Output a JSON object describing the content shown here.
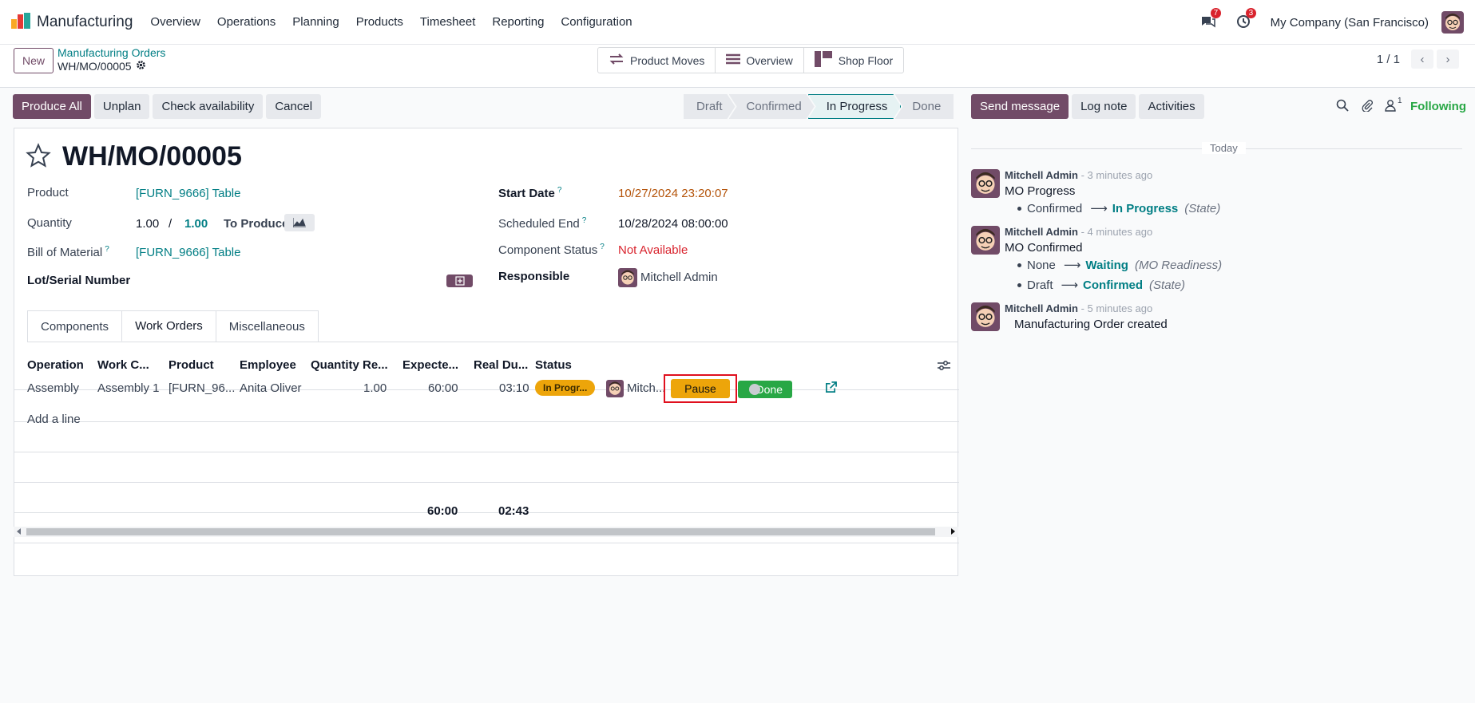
{
  "app": {
    "name": "Manufacturing",
    "menu": [
      "Overview",
      "Operations",
      "Planning",
      "Products",
      "Timesheet",
      "Reporting",
      "Configuration"
    ],
    "messages_count": "7",
    "activities_count": "3",
    "company": "My Company (San Francisco)"
  },
  "control_panel": {
    "new_label": "New",
    "breadcrumb_parent": "Manufacturing Orders",
    "breadcrumb_current": "WH/MO/00005",
    "smart_buttons": [
      "Product Moves",
      "Overview",
      "Shop Floor"
    ],
    "pager": "1 / 1"
  },
  "statusbar": {
    "buttons": [
      "Produce All",
      "Unplan",
      "Check availability",
      "Cancel"
    ],
    "stages": [
      "Draft",
      "Confirmed",
      "In Progress",
      "Done"
    ],
    "active_stage": "In Progress"
  },
  "form": {
    "title": "WH/MO/00005",
    "product_label": "Product",
    "product_value": "[FURN_9666] Table",
    "quantity_label": "Quantity",
    "quantity_value": "1.00",
    "quantity_sep": "/",
    "quantity_total": "1.00",
    "to_produce": "To Produce",
    "bom_label": "Bill of Material",
    "bom_value": "[FURN_9666] Table",
    "lot_label": "Lot/Serial Number",
    "start_label": "Start Date",
    "start_value": "10/27/2024 23:20:07",
    "sched_label": "Scheduled End",
    "sched_value": "10/28/2024 08:00:00",
    "comp_label": "Component Status",
    "comp_value": "Not Available",
    "resp_label": "Responsible",
    "resp_value": "Mitchell Admin",
    "help_mark": "?"
  },
  "tabs": [
    "Components",
    "Work Orders",
    "Miscellaneous"
  ],
  "work_orders": {
    "headers": [
      "Operation",
      "Work C...",
      "Product",
      "Employee",
      "Quantity Re...",
      "Expecte...",
      "Real Du...",
      "Status"
    ],
    "row": {
      "operation": "Assembly",
      "workcenter": "Assembly 1",
      "product": "[FURN_96...",
      "employee": "Anita Oliver",
      "quantity": "1.00",
      "expected": "60:00",
      "real": "03:10",
      "status": "In Progr...",
      "user": "Mitch...",
      "pause": "Pause",
      "done": "Done"
    },
    "add_line": "Add a line",
    "total_expected": "60:00",
    "total_real": "02:43"
  },
  "chatter": {
    "buttons": [
      "Send message",
      "Log note",
      "Activities"
    ],
    "followers_count": "1",
    "following": "Following",
    "date_sep": "Today",
    "messages": [
      {
        "author": "Mitchell Admin",
        "when": "- 3 minutes ago",
        "body": "MO Progress",
        "tracking": [
          {
            "old": "Confirmed",
            "new": "In Progress",
            "field": "(State)"
          }
        ]
      },
      {
        "author": "Mitchell Admin",
        "when": "- 4 minutes ago",
        "body": "MO Confirmed",
        "tracking": [
          {
            "old": "None",
            "new": "Waiting",
            "field": "(MO Readiness)"
          },
          {
            "old": "Draft",
            "new": "Confirmed",
            "field": "(State)"
          }
        ]
      },
      {
        "author": "Mitchell Admin",
        "when": "- 5 minutes ago",
        "body": "Manufacturing Order created",
        "tracking": []
      }
    ]
  },
  "colors": {
    "primary": "#714b67",
    "link": "#017e84",
    "warning": "#eda50a",
    "success": "#28a745",
    "danger": "#d9232d"
  }
}
